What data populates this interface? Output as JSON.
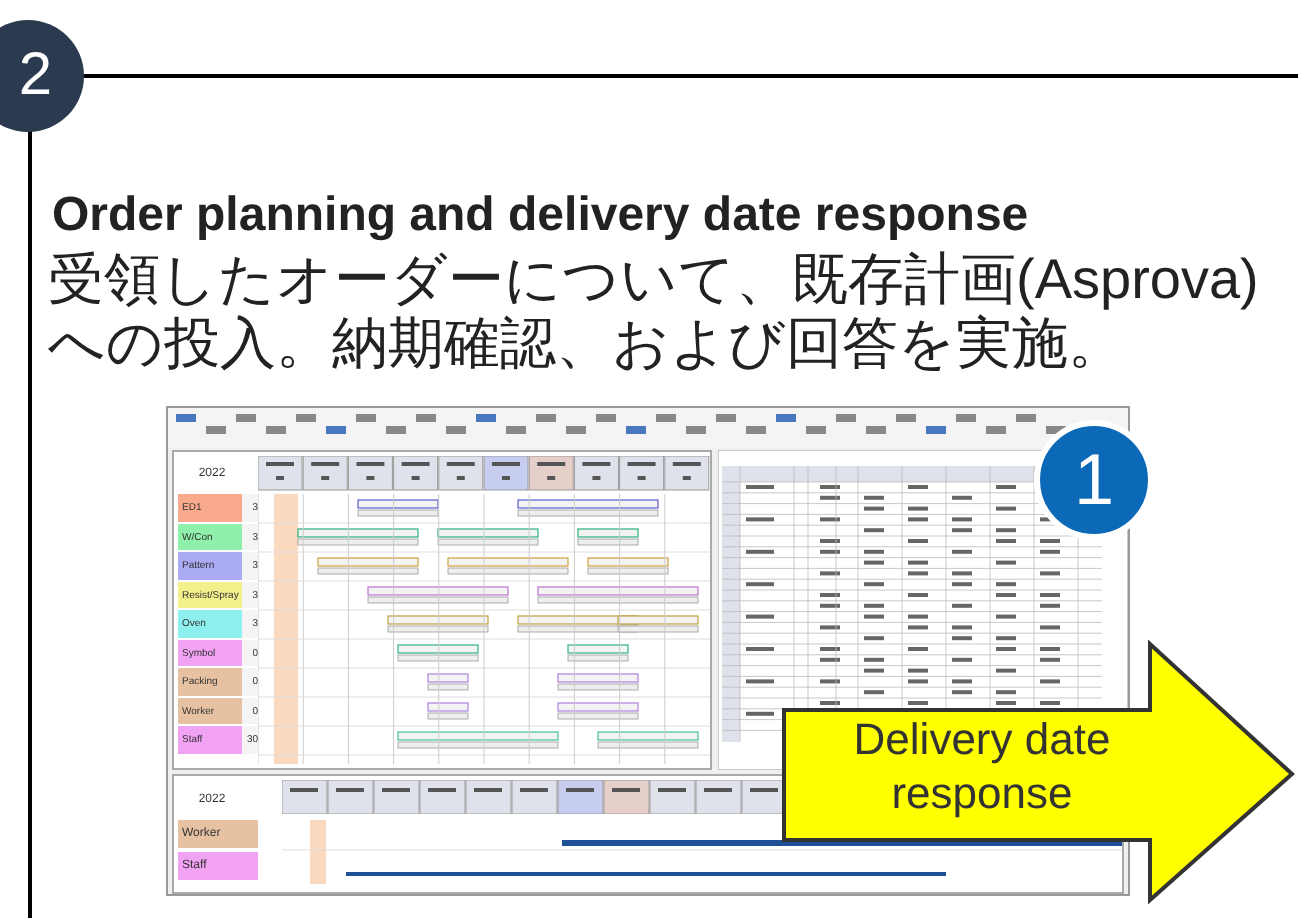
{
  "step_badge": "2",
  "title": "Order planning and delivery date response",
  "description": "受領したオーダーについて、既存計画(Asprova)への投入。納期確認、および回答を実施。",
  "app_screenshot": {
    "year": "2022",
    "resources": [
      {
        "name": "ED1",
        "count": "3",
        "color": "#f9aa8c"
      },
      {
        "name": "W/Con",
        "count": "3",
        "color": "#8ef0aa"
      },
      {
        "name": "Pattern",
        "count": "3",
        "color": "#aaaaf5"
      },
      {
        "name": "Resist/Spray",
        "count": "3",
        "color": "#f3ef8a"
      },
      {
        "name": "Oven",
        "count": "3",
        "color": "#8ef0ee"
      },
      {
        "name": "Symbol",
        "count": "0",
        "color": "#f2a2f2"
      },
      {
        "name": "Packing",
        "count": "0",
        "color": "#e6c2a2"
      },
      {
        "name": "Worker",
        "count": "0",
        "color": "#e6c2a2"
      },
      {
        "name": "Staff",
        "count": "30",
        "color": "#f2a2f2"
      }
    ],
    "lower_year": "2022",
    "lower_resources": [
      {
        "name": "Worker",
        "color": "#e6c2a2"
      },
      {
        "name": "Staff",
        "color": "#f2a2f2"
      }
    ]
  },
  "callout_badge": "1",
  "arrow_label": "Delivery date response"
}
